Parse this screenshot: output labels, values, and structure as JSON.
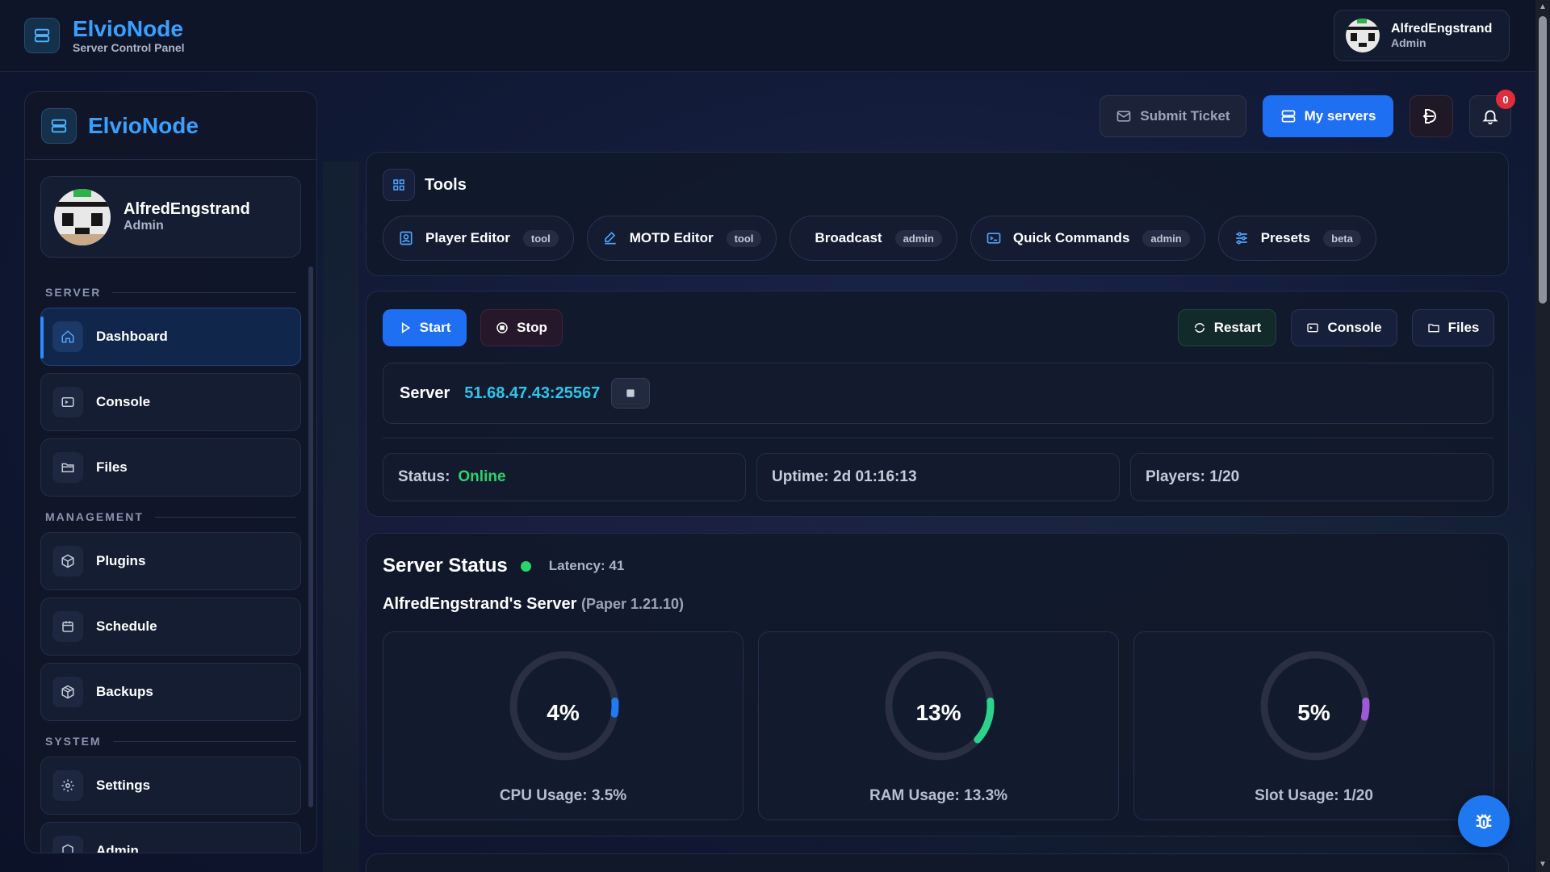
{
  "app": {
    "name": "ElvioNode",
    "subtitle": "Server Control Panel"
  },
  "user": {
    "name": "AlfredEngstrand",
    "role": "Admin"
  },
  "header": {
    "submit_ticket": "Submit Ticket",
    "my_servers": "My servers",
    "notification_count": "0"
  },
  "sidebar": {
    "brand": "ElvioNode",
    "sections": {
      "server": "SERVER",
      "management": "MANAGEMENT",
      "system": "SYSTEM"
    },
    "items": [
      {
        "label": "Dashboard",
        "icon": "home-icon",
        "active": true
      },
      {
        "label": "Console",
        "icon": "terminal-icon"
      },
      {
        "label": "Files",
        "icon": "folder-icon"
      },
      {
        "label": "Plugins",
        "icon": "cube-icon"
      },
      {
        "label": "Schedule",
        "icon": "calendar-icon"
      },
      {
        "label": "Backups",
        "icon": "package-icon"
      },
      {
        "label": "Settings",
        "icon": "gear-icon"
      },
      {
        "label": "Admin",
        "icon": "shield-icon"
      }
    ]
  },
  "tools": {
    "title": "Tools",
    "items": [
      {
        "label": "Player Editor",
        "tag": "tool",
        "icon": "user-card-icon"
      },
      {
        "label": "MOTD Editor",
        "tag": "tool",
        "icon": "pencil-icon"
      },
      {
        "label": "Broadcast",
        "tag": "admin",
        "icon": ""
      },
      {
        "label": "Quick Commands",
        "tag": "admin",
        "icon": "terminal-icon"
      },
      {
        "label": "Presets",
        "tag": "beta",
        "icon": "sliders-icon"
      }
    ]
  },
  "control": {
    "start": "Start",
    "stop": "Stop",
    "restart": "Restart",
    "console": "Console",
    "files": "Files",
    "server_label": "Server",
    "address": "51.68.47.43:25567",
    "status_label": "Status:",
    "status_value": "Online",
    "uptime": "Uptime: 2d 01:16:13",
    "players": "Players: 1/20"
  },
  "server_status": {
    "title": "Server Status",
    "latency": "Latency: 41",
    "server_name": "AlfredEngstrand's Server",
    "version": "(Paper 1.21.10)",
    "gauges": [
      {
        "value_text": "4%",
        "fraction": 0.04,
        "label": "CPU Usage: 3.5%",
        "color": "#1e7bf0"
      },
      {
        "value_text": "13%",
        "fraction": 0.13,
        "label": "RAM Usage: 13.3%",
        "color": "#2bd48a"
      },
      {
        "value_text": "5%",
        "fraction": 0.05,
        "label": "Slot Usage: 1/20",
        "color": "#a057d8"
      }
    ]
  },
  "colors": {
    "accent": "#1f6ff2",
    "brand": "#3aa0ff",
    "online": "#2bd46a",
    "address": "#2ec6e8"
  }
}
